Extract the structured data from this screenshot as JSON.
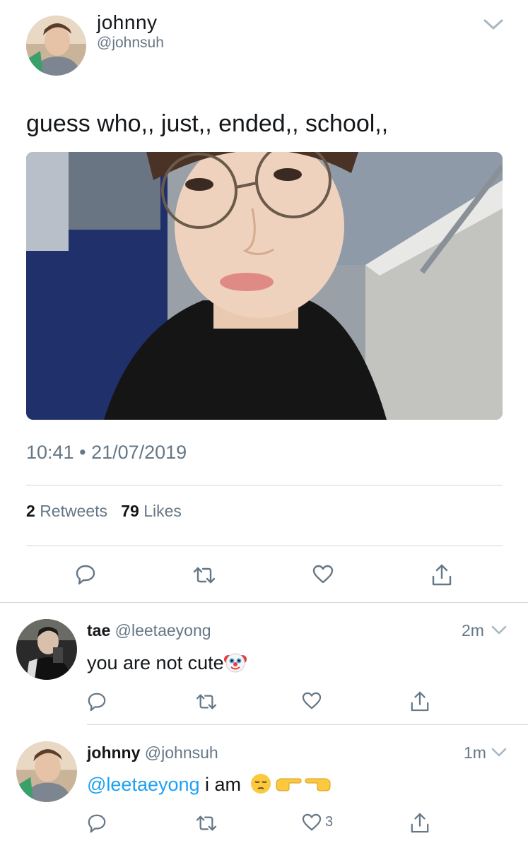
{
  "tweet": {
    "display_name": "johnny",
    "handle": "@johnsuh",
    "text": "guess who,, just,, ended,, school,,",
    "time": "10:41",
    "separator": "•",
    "date": "21/07/2019",
    "retweets_count": "2",
    "retweets_label": "Retweets",
    "likes_count": "79",
    "likes_label": "Likes"
  },
  "replies": [
    {
      "display_name": "tae",
      "handle": "@leetaeyong",
      "time": "2m",
      "text": "you are not cute",
      "emoji": "clown-face"
    },
    {
      "display_name": "johnny",
      "handle": "@johnsuh",
      "time": "1m",
      "mention": "@leetaeyong",
      "text": " i am",
      "emojis": [
        "pensive-face",
        "backhand-index-pointing-right",
        "left-facing-hand"
      ],
      "likes_count": "3"
    }
  ],
  "icons": {
    "reply": "reply-icon",
    "retweet": "retweet-icon",
    "like": "heart-icon",
    "share": "share-icon",
    "more": "chevron-down-icon"
  },
  "colors": {
    "accent": "#1da1f2",
    "secondary_text": "#657786",
    "divider": "#ccd6dd"
  }
}
